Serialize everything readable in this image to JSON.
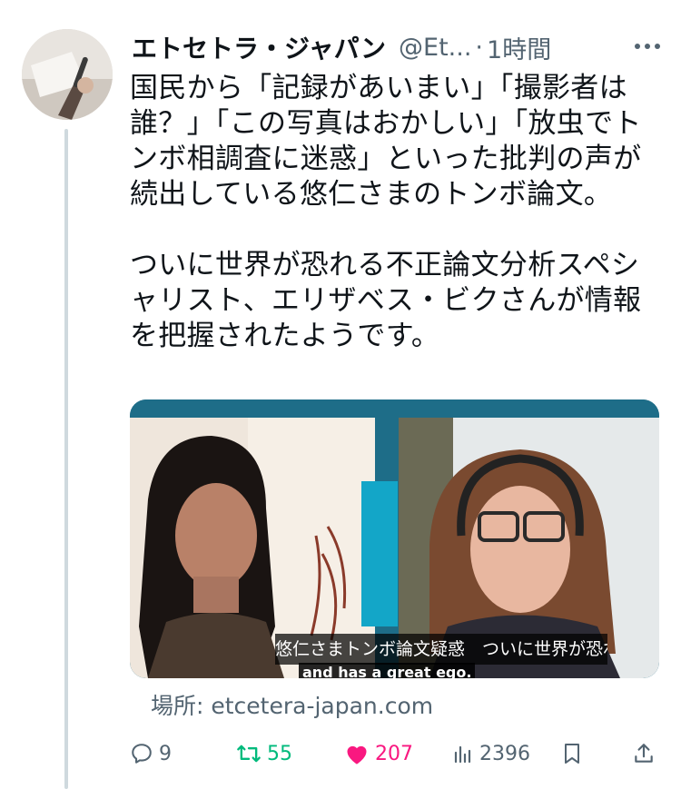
{
  "author": {
    "name": "エトセトラ・ジャパン",
    "handle": "@Et...",
    "separator": "·",
    "time": "1時間"
  },
  "tweet": {
    "text": "国民から「記録があいまい」「撮影者は誰？」「この写真はおかしい」「放虫でトンボ相調査に迷惑」といった批判の声が続出している悠仁さまのトンボ論文。\n\nついに世界が恐れる不正論文分析スペシャリスト、エリザベス・ビクさんが情報を把握されたようです。"
  },
  "media": {
    "subtitle": "悠仁さまトンボ論文疑惑　ついに世界が恐れる…",
    "caption": "and has a great ego."
  },
  "source": {
    "label": "場所: etcetera-japan.com"
  },
  "actions": {
    "replies": "9",
    "retweets": "55",
    "likes": "207",
    "views": "2396"
  },
  "icons": {
    "more": "more-icon",
    "reply": "reply-icon",
    "retweet": "retweet-icon",
    "like": "heart-icon",
    "views": "views-icon",
    "bookmark": "bookmark-icon",
    "share": "share-icon"
  },
  "colors": {
    "retweet": "#00ba7c",
    "like": "#f91880",
    "secondary": "#536471",
    "text": "#0f1419"
  }
}
